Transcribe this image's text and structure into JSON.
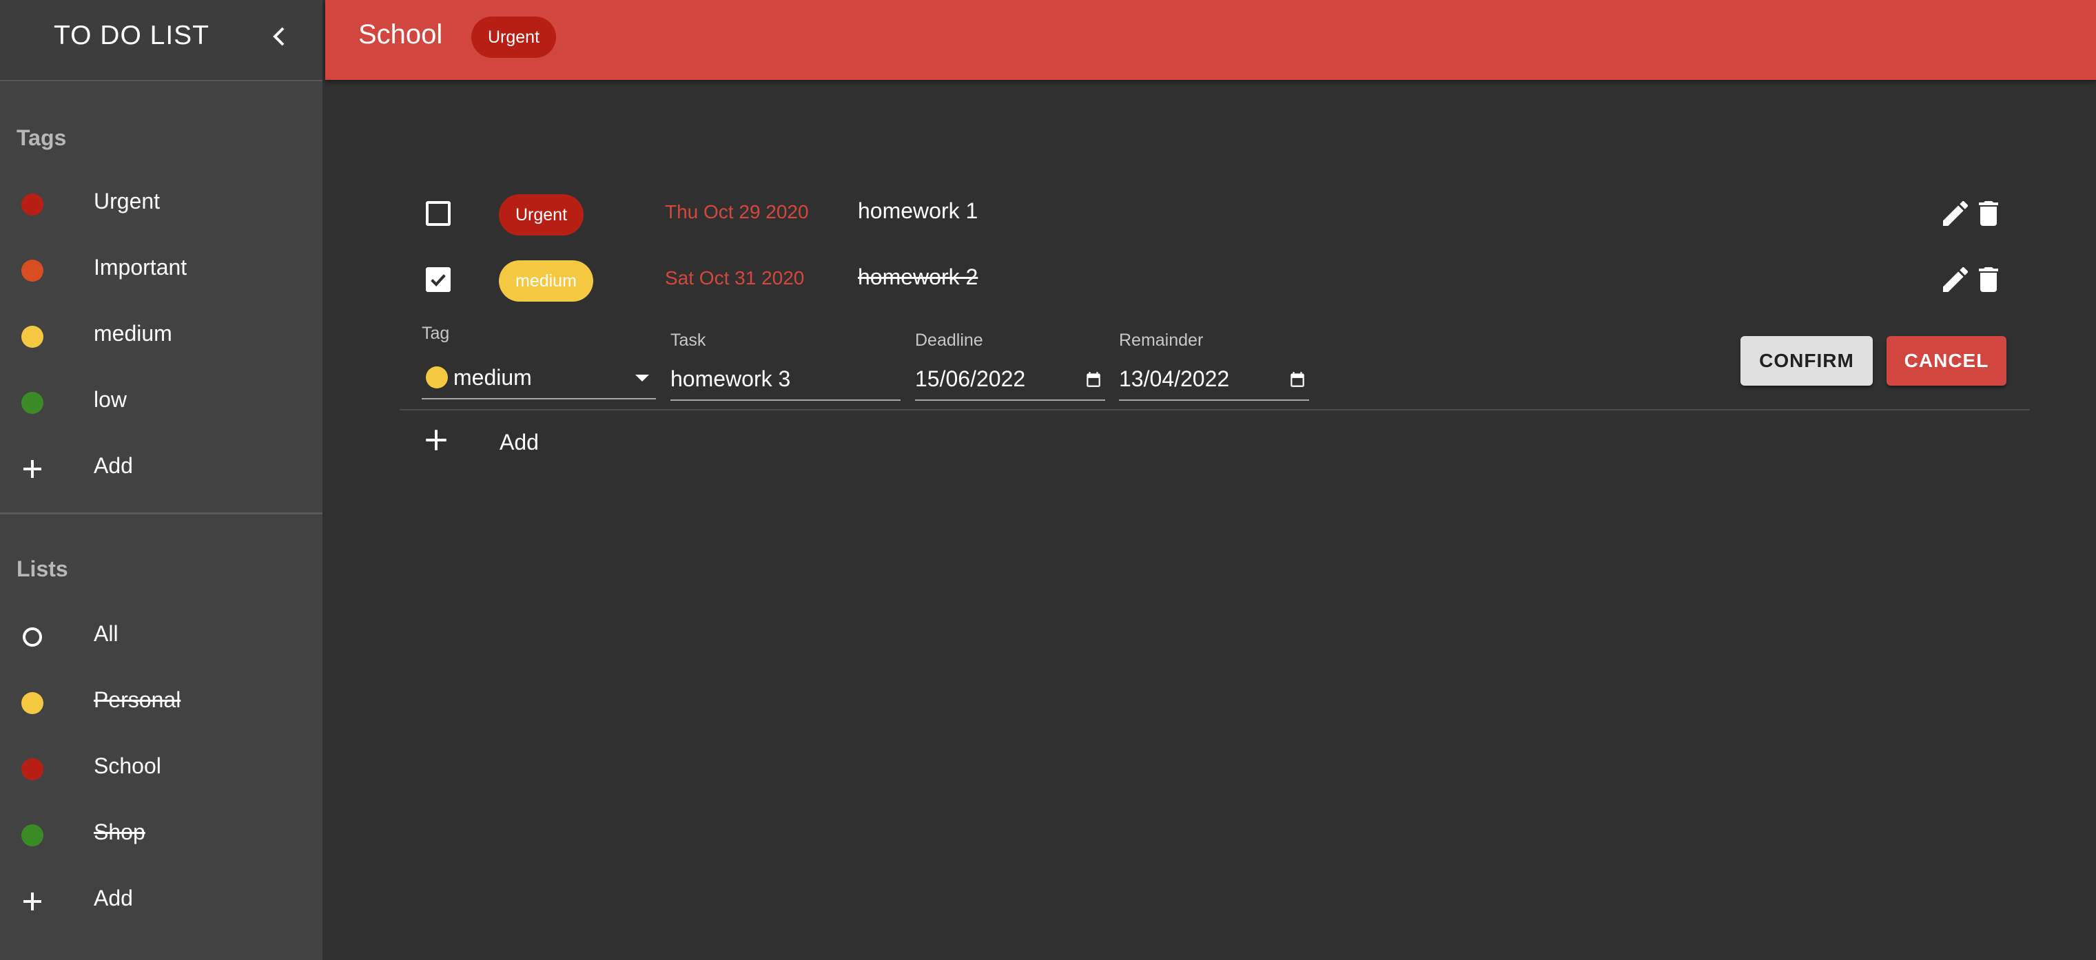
{
  "app": {
    "title": "TO DO LIST"
  },
  "colors": {
    "accent": "#d1473f",
    "urgent": "#b71f14",
    "important": "#d84e21",
    "medium": "#f5c842",
    "low": "#3a8a26"
  },
  "sidebar": {
    "tags_title": "Tags",
    "tags": [
      {
        "label": "Urgent",
        "color": "#b71f14"
      },
      {
        "label": "Important",
        "color": "#d84e21"
      },
      {
        "label": "medium",
        "color": "#f5c842"
      },
      {
        "label": "low",
        "color": "#3a8a26"
      }
    ],
    "tags_add": "Add",
    "lists_title": "Lists",
    "lists": [
      {
        "label": "All",
        "icon": "ring-icon"
      },
      {
        "label": "Personal",
        "color": "#f5c842",
        "strikethrough": true
      },
      {
        "label": "School",
        "color": "#b71f14"
      },
      {
        "label": "Shop",
        "color": "#3a8a26",
        "strikethrough": true
      }
    ],
    "lists_add": "Add"
  },
  "header": {
    "title": "School",
    "chip": "Urgent"
  },
  "tasks": [
    {
      "checked": false,
      "tag": "Urgent",
      "tag_color": "#b71f14",
      "date": "Thu Oct 29 2020",
      "name": "homework 1",
      "done": false
    },
    {
      "checked": true,
      "tag": "medium",
      "tag_color": "#f5c842",
      "date": "Sat Oct 31 2020",
      "name": "homework 2",
      "done": true
    }
  ],
  "edit": {
    "tag_label": "Tag",
    "tag_value": "medium",
    "task_label": "Task",
    "task_value": "homework 3",
    "deadline_label": "Deadline",
    "deadline_value": "15/06/2022",
    "remainder_label": "Remainder",
    "remainder_value": "13/04/2022",
    "confirm": "CONFIRM",
    "cancel": "CANCEL"
  },
  "add_task_label": "Add"
}
